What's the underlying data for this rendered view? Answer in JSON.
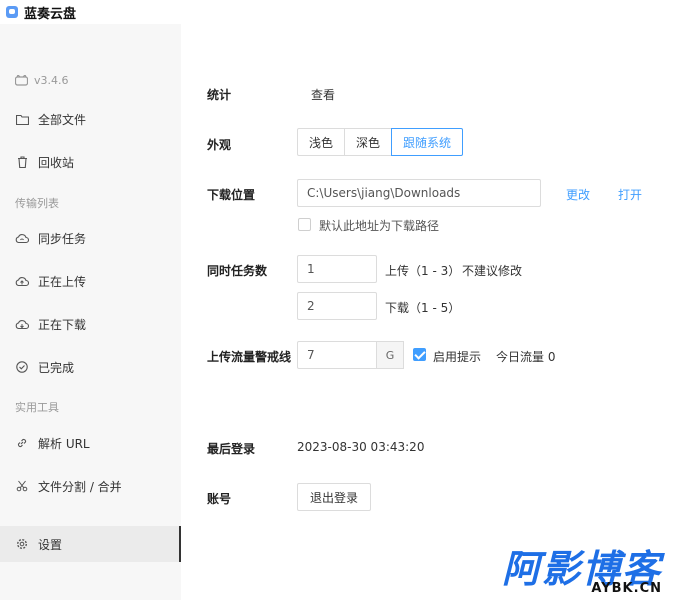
{
  "app": {
    "title": "蓝奏云盘",
    "version": "v3.4.6"
  },
  "sidebar": {
    "items": [
      {
        "label": "全部文件",
        "icon": "folder-icon"
      },
      {
        "label": "回收站",
        "icon": "trash-icon"
      },
      {
        "label": "同步任务",
        "icon": "cloud-sync-icon"
      },
      {
        "label": "正在上传",
        "icon": "cloud-upload-icon"
      },
      {
        "label": "正在下载",
        "icon": "cloud-download-icon"
      },
      {
        "label": "已完成",
        "icon": "check-circle-icon"
      },
      {
        "label": "解析 URL",
        "icon": "link-icon"
      },
      {
        "label": "文件分割 / 合并",
        "icon": "scissors-icon"
      },
      {
        "label": "设置",
        "icon": "gear-icon",
        "active": true
      }
    ],
    "sections": {
      "transfer": "传输列表",
      "tools": "实用工具"
    }
  },
  "settings": {
    "stats": {
      "label": "统计",
      "action": "查看"
    },
    "appearance": {
      "label": "外观",
      "options": [
        "浅色",
        "深色",
        "跟随系统"
      ],
      "selected": "跟随系统"
    },
    "download": {
      "label": "下载位置",
      "path": "C:\\Users\\jiang\\Downloads",
      "change": "更改",
      "open": "打开",
      "default_checkbox": "默认此地址为下载路径"
    },
    "concurrency": {
      "label": "同时任务数",
      "upload_value": "1",
      "upload_text": "上传（1 - 3）",
      "upload_hint": "不建议修改",
      "download_value": "2",
      "download_text": "下载（1 - 5）"
    },
    "upload_limit": {
      "label": "上传流量警戒线",
      "value": "7",
      "unit": "G",
      "enable_text": "启用提示",
      "today": "今日流量 0"
    },
    "last_login": {
      "label": "最后登录",
      "value": "2023-08-30 03:43:20"
    },
    "account": {
      "label": "账号",
      "logout": "退出登录"
    }
  },
  "watermark": {
    "main": "阿影博客",
    "sub": "AYBK.CN"
  },
  "colors": {
    "accent": "#409eff",
    "sidebar_bg": "#f7f7f7",
    "watermark": "#1e6fe6"
  }
}
